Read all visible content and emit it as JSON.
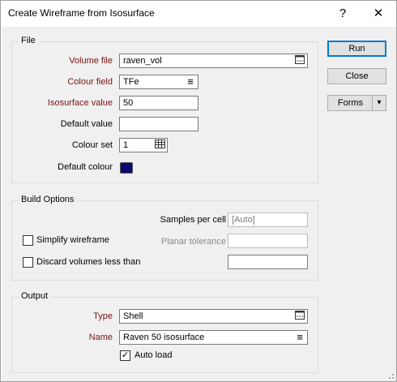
{
  "window": {
    "title": "Create Wireframe from Isosurface",
    "help_glyph": "?",
    "close_glyph": "✕"
  },
  "file": {
    "group_title": "File",
    "volume_file_label": "Volume file",
    "volume_file_value": "raven_vol",
    "colour_field_label": "Colour field",
    "colour_field_value": "TFe",
    "isosurface_value_label": "Isosurface value",
    "isosurface_value": "50",
    "default_value_label": "Default value",
    "default_value": "",
    "colour_set_label": "Colour set",
    "colour_set_value": "1",
    "default_colour_label": "Default colour",
    "default_colour": "#0a0a6e"
  },
  "build": {
    "group_title": "Build Options",
    "samples_per_cell_label": "Samples per cell",
    "samples_per_cell_value": "[Auto]",
    "simplify_label": "Simplify wireframe",
    "simplify_checked": false,
    "planar_tolerance_label": "Planar tolerance",
    "planar_tolerance_value": "",
    "discard_label": "Discard volumes less than",
    "discard_checked": false,
    "discard_value": ""
  },
  "output": {
    "group_title": "Output",
    "type_label": "Type",
    "type_value": "Shell",
    "name_label": "Name",
    "name_value": "Raven 50 isosurface",
    "auto_load_label": "Auto load",
    "auto_load_checked": true,
    "check_glyph": "✓"
  },
  "buttons": {
    "run": "Run",
    "close": "Close",
    "forms": "Forms",
    "forms_arrow": "▾"
  },
  "icons": {
    "browse": "browse-icon",
    "list": "list-icon",
    "colour_set": "colour-set-icon",
    "list_glyph": "≡",
    "browse_glyph": "…"
  },
  "colors": {
    "required_label": "#7a1212",
    "accent": "#0078d7"
  }
}
